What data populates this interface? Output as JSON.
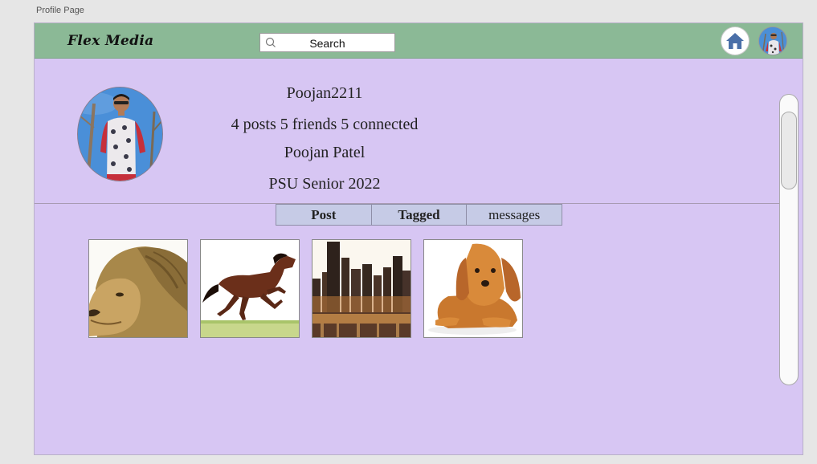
{
  "canvas_label": "Profile Page",
  "app": {
    "brand": "Flex Media"
  },
  "search": {
    "label": "Search"
  },
  "profile": {
    "username": "Poojan2211",
    "stats": "4 posts 5 friends 5 connected",
    "full_name": "Poojan Patel",
    "bio": "PSU Senior 2022"
  },
  "tabs": [
    {
      "label": "Post"
    },
    {
      "label": "Tagged"
    },
    {
      "label": "messages"
    }
  ],
  "posts": [
    {
      "subject": "lion"
    },
    {
      "subject": "horse"
    },
    {
      "subject": "city-skyline"
    },
    {
      "subject": "puppy"
    }
  ],
  "colors": {
    "topbar": "#8bb996",
    "page_background": "#d7c6f3",
    "tab_background": "#c6cbe6",
    "home_icon": "#4a6fa8"
  }
}
